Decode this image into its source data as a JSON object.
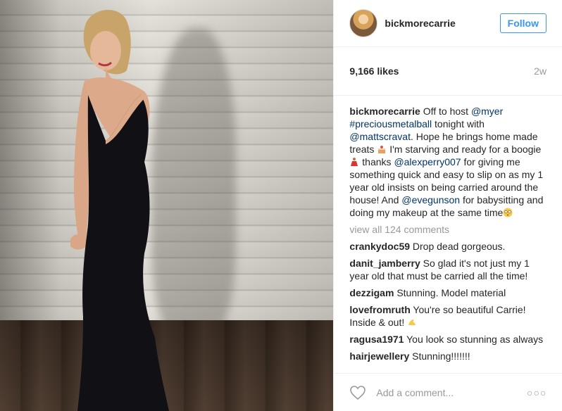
{
  "post": {
    "username": "bickmorecarrie",
    "follow_label": "Follow",
    "likes": "9,166 likes",
    "age": "2w",
    "caption": {
      "username": "bickmorecarrie",
      "p1": "Off to host ",
      "mention1": "@myer",
      "sp1": " ",
      "hashtag1": "#preciousmetalball",
      "p2": " tonight with ",
      "mention2": "@mattscravat",
      "p3": ". Hope he brings home made treats ",
      "p4": " I'm starving and ready for a boogie ",
      "p5": " thanks ",
      "mention3": "@alexperry007",
      "p6": " for giving me something quick and easy to slip on as my 1 year old insists on being carried around the house! And ",
      "mention4": "@evegunson",
      "p7": " for babysitting and doing my makeup at the same time"
    },
    "view_all": "view all 124 comments",
    "comments": [
      {
        "user": "crankydoc59",
        "text": "Drop dead gorgeous."
      },
      {
        "user": "danit_jamberry",
        "text": "So glad it's not just my 1 year old that must be carried all the time!"
      },
      {
        "user": "dezzigam",
        "text": "Stunning. Model material"
      },
      {
        "user": "lovefromruth",
        "text": "You're so beautiful Carrie! Inside & out!"
      },
      {
        "user": "ragusa1971",
        "text": "You look so stunning as always"
      },
      {
        "user": "hairjewellery",
        "text": "Stunning!!!!!!!"
      }
    ],
    "comment_placeholder": "Add a comment...",
    "more_label": "○○○"
  },
  "icons": {
    "heart": "heart-icon",
    "more": "more-options-icon",
    "emoji_treats": "cake-emoji",
    "emoji_dance": "dancer-emoji",
    "emoji_flushed": "flushed-face-emoji",
    "emoji_muscle": "muscle-emoji"
  },
  "colors": {
    "link": "#003569",
    "follow": "#3897f0",
    "muted": "#999999"
  }
}
